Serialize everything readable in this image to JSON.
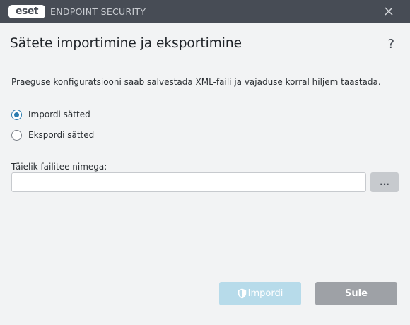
{
  "titlebar": {
    "logo_text": "eset",
    "product_name": "ENDPOINT SECURITY"
  },
  "dialog": {
    "title": "Sätete importimine ja eksportimine",
    "help_label": "?",
    "description": "Praeguse konfiguratsiooni saab salvestada XML-faili ja vajaduse korral hiljem taastada.",
    "options": [
      {
        "label": "Impordi sätted",
        "checked": true
      },
      {
        "label": "Ekspordi sätted",
        "checked": false
      }
    ],
    "path_label": "Täielik failitee nimega:",
    "path_value": "",
    "browse_label": "...",
    "import_label": "Impordi",
    "close_label": "Sule"
  },
  "colors": {
    "titlebar_bg": "#474c55",
    "accent": "#2b7cb0",
    "import_button_disabled": "#b7dbea",
    "close_button": "#9ea1a6",
    "background": "#f2f3f4"
  },
  "icons": {
    "close": "close-icon",
    "help": "help-icon",
    "shield": "shield-icon"
  }
}
